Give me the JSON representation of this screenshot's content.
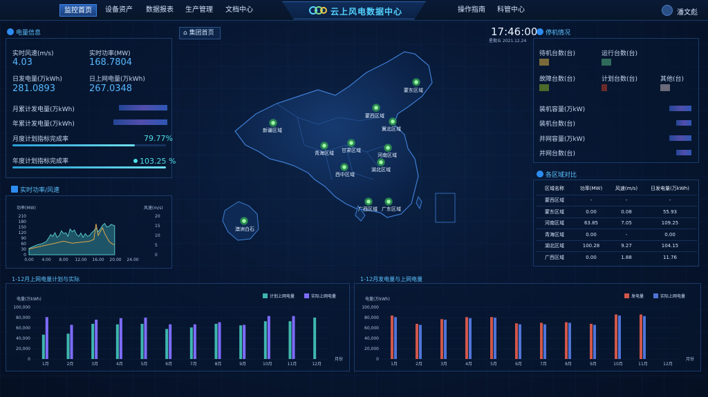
{
  "nav": {
    "left_items": [
      {
        "label": "监控首页",
        "active": true
      },
      {
        "label": "设备资产"
      },
      {
        "label": "数据报表"
      },
      {
        "label": "生产管理"
      },
      {
        "label": "文档中心"
      }
    ],
    "title": "云上风电数据中心",
    "right_items": [
      {
        "label": "操作指南"
      },
      {
        "label": "科管中心"
      }
    ],
    "user_name": "潘文彪"
  },
  "power_info": {
    "title": "电量信息",
    "realtime_wind_label": "实时风速(m/s)",
    "realtime_wind_value": "4.03",
    "realtime_power_label": "实时功率(MW)",
    "realtime_power_value": "168.7804",
    "daily_gen_label": "日发电量(万kWh)",
    "daily_gen_value": "281.0893",
    "daily_grid_label": "日上网电量(万kWh)",
    "daily_grid_value": "267.0348",
    "monthly_gen_label": "月累计发电量(万kWh)",
    "yearly_gen_label": "年累计发电量(万kWh)",
    "monthly_plan_label": "月度计划指标完成率",
    "monthly_plan_value": "79.77%",
    "monthly_plan_fraction": 0.7977,
    "yearly_plan_label": "年度计划指标完成率",
    "yearly_plan_value": "103.25 %",
    "yearly_plan_fraction": 1.0
  },
  "home_button": "集团首页",
  "clock": {
    "time": "17:46:00",
    "date": "星期五 2021.12.24"
  },
  "map_regions": [
    {
      "name": "蒙东区域"
    },
    {
      "name": "蒙西区域"
    },
    {
      "name": "冀北区域"
    },
    {
      "name": "新疆区域"
    },
    {
      "name": "甘肃区域"
    },
    {
      "name": "青海区域"
    },
    {
      "name": "河南区域"
    },
    {
      "name": "湖北区域"
    },
    {
      "name": "西中区域"
    },
    {
      "name": "广西区域"
    },
    {
      "name": "广东区域"
    },
    {
      "name": "澳洲白石"
    }
  ],
  "status": {
    "title": "停机情况",
    "standby_label": "待机台数(台)",
    "running_label": "运行台数(台)",
    "fault_label": "故障台数(台)",
    "plan_label": "计划台数(台)",
    "other_label": "其他(台)",
    "installed_cap_label": "装机容量(万kW)",
    "installed_units_label": "装机台数(台)",
    "grid_cap_label": "并网容量(万kW)",
    "grid_units_label": "并网台数(台)",
    "colors": {
      "standby": "#7a6a3a",
      "running": "#2e6b5a",
      "fault": "#4a6b2a",
      "plan": "#6b2a2a",
      "other": "#6a6a7a"
    }
  },
  "region_compare": {
    "title": "各区域对比",
    "headers": [
      "区域名称",
      "功率(MW)",
      "风速(m/s)",
      "日发电量(万kWh)"
    ],
    "rows": [
      [
        "蒙西区域",
        "-",
        "-",
        "-"
      ],
      [
        "蒙东区域",
        "0.00",
        "0.08",
        "55.93"
      ],
      [
        "河南区域",
        "63.85",
        "7.05",
        "109.25"
      ],
      [
        "青海区域",
        "0.00",
        "-",
        "0.00"
      ],
      [
        "湖北区域",
        "100.28",
        "9.27",
        "104.15"
      ],
      [
        "广西区域",
        "0.00",
        "1.88",
        "11.76"
      ]
    ]
  },
  "realtime_chart": {
    "title": "实时功率/风速",
    "chart_data": {
      "type": "area",
      "left_axis_label": "功率(MW)",
      "right_axis_label": "风速(m/s)",
      "x_ticks": [
        "0.00",
        "4.00",
        "8.00",
        "12.00",
        "16.00",
        "20.00",
        "24.00"
      ],
      "left_ticks": [
        0,
        30,
        60,
        90,
        120,
        150,
        180,
        210
      ],
      "right_ticks": [
        0,
        5,
        10,
        15,
        20
      ],
      "ylim_left": [
        0,
        210
      ],
      "ylim_right": [
        0,
        20
      ],
      "power": [
        [
          0,
          35
        ],
        [
          1,
          45
        ],
        [
          2,
          55
        ],
        [
          3,
          60
        ],
        [
          4,
          72
        ],
        [
          4.5,
          90
        ],
        [
          5,
          110
        ],
        [
          5.5,
          100
        ],
        [
          6,
          120
        ],
        [
          6.5,
          95
        ],
        [
          7,
          105
        ],
        [
          7.5,
          130
        ],
        [
          8,
          115
        ],
        [
          8.5,
          120
        ],
        [
          9,
          100
        ],
        [
          9.5,
          140
        ],
        [
          10,
          125
        ],
        [
          10.5,
          135
        ],
        [
          11,
          110
        ],
        [
          11.5,
          100
        ],
        [
          12,
          118
        ],
        [
          12.5,
          95
        ],
        [
          13,
          115
        ],
        [
          13.5,
          100
        ],
        [
          14,
          105
        ],
        [
          14.5,
          120
        ],
        [
          15,
          130
        ],
        [
          15.5,
          145
        ],
        [
          16,
          125
        ],
        [
          16.5,
          140
        ],
        [
          17,
          160
        ],
        [
          17.5,
          170
        ],
        [
          18,
          150
        ],
        [
          18.5,
          155
        ],
        [
          19,
          165
        ],
        [
          19.5,
          160
        ],
        [
          19.8,
          158
        ]
      ],
      "wind": [
        [
          0,
          3
        ],
        [
          2,
          4
        ],
        [
          4,
          5
        ],
        [
          6,
          6
        ],
        [
          8,
          7
        ],
        [
          10,
          6
        ],
        [
          12,
          6.5
        ],
        [
          14,
          7
        ],
        [
          15,
          8
        ],
        [
          15.5,
          16
        ],
        [
          16,
          10
        ],
        [
          16.5,
          12
        ],
        [
          17,
          14
        ],
        [
          17.5,
          11
        ],
        [
          18,
          9
        ],
        [
          18.5,
          7
        ],
        [
          19,
          6
        ],
        [
          19.8,
          5
        ]
      ]
    }
  },
  "monthly_plan_chart": {
    "title": "1-12月上网电量计划与实际",
    "chart_data": {
      "type": "bar",
      "ylabel": "电量(万kWh)",
      "xlabel": "月份",
      "ylim": [
        0,
        100000
      ],
      "y_ticks": [
        "0",
        "20,000",
        "40,000",
        "60,000",
        "80,000",
        "100,000"
      ],
      "categories": [
        "1月",
        "2月",
        "3月",
        "4月",
        "5月",
        "6月",
        "7月",
        "8月",
        "9月",
        "10月",
        "11月",
        "12月"
      ],
      "series": [
        {
          "name": "计划上网电量",
          "color": "#3fb6b0",
          "values": [
            47000,
            49000,
            68000,
            67000,
            68000,
            58000,
            61000,
            68000,
            65000,
            73000,
            73000,
            80000
          ]
        },
        {
          "name": "实际上网电量",
          "color": "#7e6cff",
          "values": [
            81000,
            66000,
            76000,
            79000,
            80000,
            67000,
            67000,
            71000,
            66000,
            83000,
            83000,
            0
          ]
        }
      ]
    }
  },
  "monthly_gen_chart": {
    "title": "1-12月发电量与上网电量",
    "chart_data": {
      "type": "bar",
      "ylabel": "电量(万kWh)",
      "xlabel": "月份",
      "ylim": [
        0,
        100000
      ],
      "y_ticks": [
        "0",
        "20,000",
        "40,000",
        "60,000",
        "80,000",
        "100,000"
      ],
      "categories": [
        "1月",
        "2月",
        "3月",
        "4月",
        "5月",
        "6月",
        "7月",
        "8月",
        "9月",
        "10月",
        "11月",
        "12月"
      ],
      "series": [
        {
          "name": "发电量",
          "color": "#d0574a",
          "values": [
            84000,
            68000,
            77000,
            81000,
            81000,
            69000,
            70000,
            71000,
            68000,
            86000,
            86000,
            0
          ]
        },
        {
          "name": "实际上网电量",
          "color": "#4f74d8",
          "values": [
            81000,
            66000,
            76000,
            79000,
            80000,
            67000,
            67000,
            70000,
            66000,
            84000,
            83000,
            0
          ]
        }
      ]
    }
  }
}
